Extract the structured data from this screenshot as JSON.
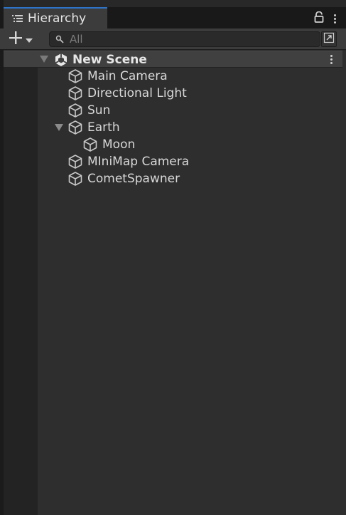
{
  "window": {
    "tab_title": "Hierarchy"
  },
  "toolbar": {
    "search_placeholder": "All"
  },
  "scene": {
    "name": "New Scene"
  },
  "objects": [
    {
      "label": "Main Camera",
      "icon": "cube-icon"
    },
    {
      "label": "Directional Light",
      "icon": "cube-icon"
    },
    {
      "label": "Sun",
      "icon": "cube-icon"
    },
    {
      "label": "Earth",
      "icon": "cube-icon",
      "expanded": true
    },
    {
      "label": "Moon",
      "icon": "cube-icon",
      "parent": "Earth"
    },
    {
      "label": "MIniMap Camera",
      "icon": "cube-icon"
    },
    {
      "label": "CometSpawner",
      "icon": "cube-icon"
    }
  ],
  "colors": {
    "panel": "#282828",
    "tab_active": "#3c3c3c",
    "tab_accent": "#2d73c7",
    "scene_row": "#404040",
    "text": "#d8d8d8"
  }
}
